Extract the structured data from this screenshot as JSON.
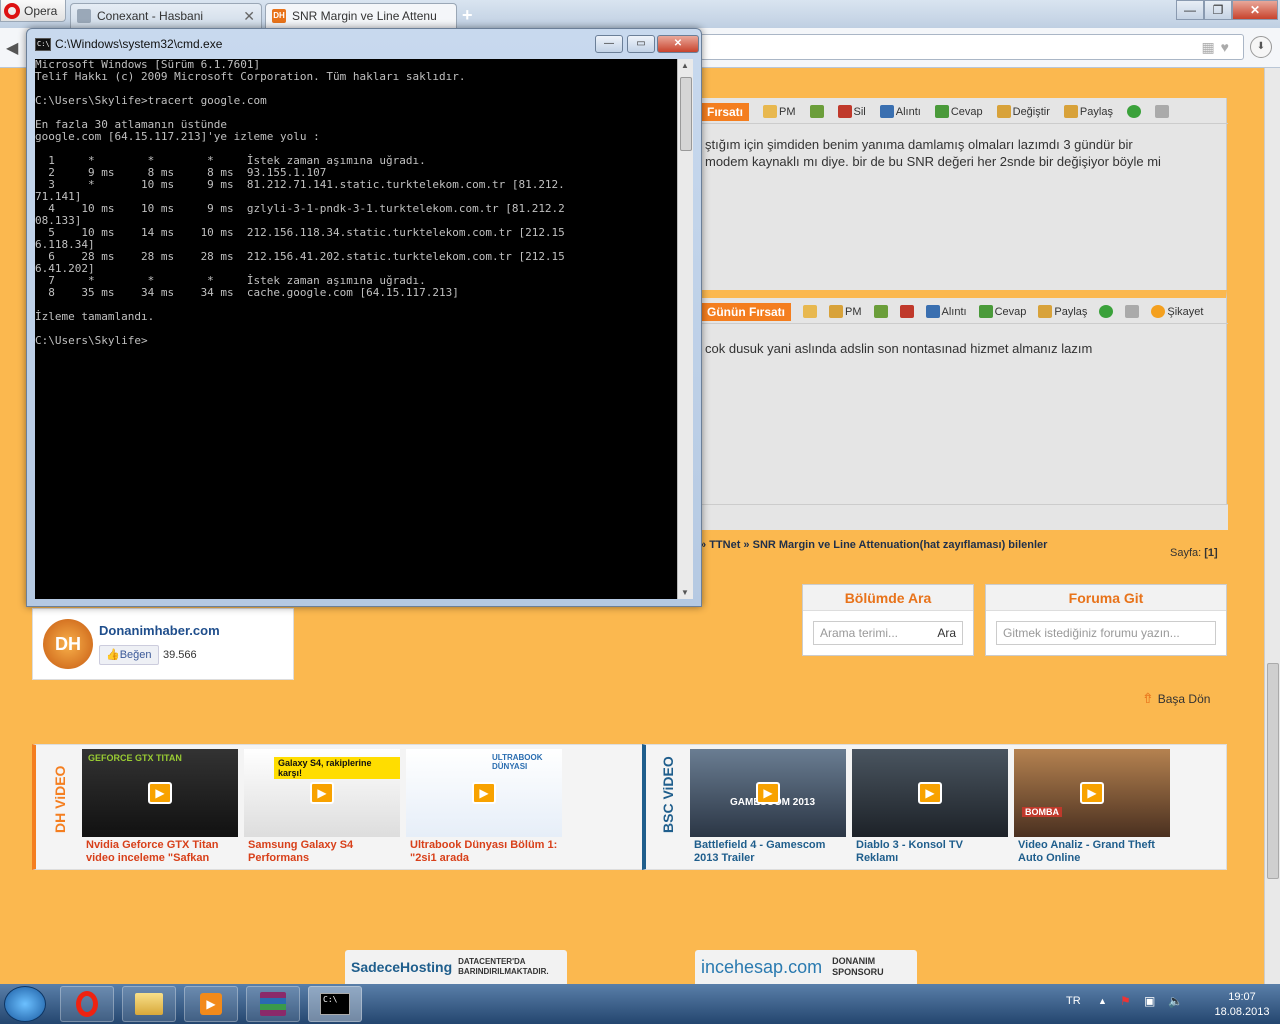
{
  "browser": {
    "opera_label": "Opera",
    "tabs": [
      {
        "label": "Conexant - Hasbani",
        "active": false
      },
      {
        "label": "SNR Margin ve Line Attenu",
        "active": true
      }
    ],
    "new_tab": "+",
    "window_controls": {
      "minimize": "—",
      "maximize": "❐",
      "close": "✕"
    }
  },
  "page": {
    "post1": {
      "firsat_label": "Fırsatı",
      "toolbar": [
        "PM",
        "Sil",
        "Alıntı",
        "Cevap",
        "Değiştir",
        "Paylaş"
      ],
      "text_line1": "ştığım için şimdiden benim yanıma damlamış olmaları lazımdı 3 gündür bir",
      "text_line2": " modem kaynaklı mı diye. bir de bu SNR değeri her 2snde bir değişiyor böyle mi"
    },
    "post2": {
      "firsat_label": "Günün Fırsatı",
      "toolbar": [
        "PM",
        "Alıntı",
        "Cevap",
        "Paylaş",
        "Şikayet"
      ],
      "text": "cok dusuk yani aslında adslin son nontasınad hizmet almanız lazım"
    },
    "breadcrumb": {
      "sep": "»",
      "ttnet": "TTNet",
      "current": "SNR Margin ve Line Attenuation(hat zayıflaması) bilenler"
    },
    "paging": {
      "label": "Sayfa:",
      "current": "[1]"
    },
    "search_box": {
      "title": "Bölümde Ara",
      "placeholder": "Arama terimi...",
      "button": "Ara"
    },
    "forum_box": {
      "title": "Foruma Git",
      "placeholder": "Gitmek istediğiniz forumu yazın..."
    },
    "facebook": {
      "name": "Donanimhaber.com",
      "like": "Beğen",
      "count": "39.566"
    },
    "back_to_top": "Başa Dön",
    "dh_video": {
      "label": "DH ViDEO",
      "items": [
        {
          "title": "Nvidia Geforce GTX Titan video inceleme \"Safkan",
          "thumb_text": "GEFORCE GTX TITAN"
        },
        {
          "title": "Samsung Galaxy S4 Performans",
          "thumb_text": "Galaxy S4, rakiplerine karşı!"
        },
        {
          "title": "Ultrabook Dünyası Bölüm 1: \"2si1 arada",
          "thumb_text": "ULTRABOOK DÜNYASI"
        }
      ]
    },
    "bsc_video": {
      "label": "BSC ViDEO",
      "items": [
        {
          "title": "Battlefield 4 - Gamescom 2013 Trailer",
          "thumb_text": "GAMESCOM 2013"
        },
        {
          "title": "Diablo 3 - Konsol TV Reklamı",
          "thumb_text": ""
        },
        {
          "title": "Video Analiz - Grand Theft Auto Online",
          "thumb_text": "BOMBA"
        }
      ]
    },
    "sponsor1": {
      "brand": "SadeceHosting",
      "text": "DATACENTER'DA BARINDIRILMAKTADIR."
    },
    "sponsor2": {
      "brand": "incehesap.com",
      "text": "DONANIM SPONSORU"
    }
  },
  "cmd": {
    "title": "C:\\Windows\\system32\\cmd.exe",
    "icon_text": "C:\\",
    "lines": [
      "Microsoft Windows [Sürüm 6.1.7601]",
      "Telif Hakkı (c) 2009 Microsoft Corporation. Tüm hakları saklıdır.",
      "",
      "C:\\Users\\Skylife>tracert google.com",
      "",
      "En fazla 30 atlamanın üstünde",
      "google.com [64.15.117.213]'ye izleme yolu :",
      "",
      "  1     *        *        *     İstek zaman aşımına uğradı.",
      "  2     9 ms     8 ms     8 ms  93.155.1.107",
      "  3     *       10 ms     9 ms  81.212.71.141.static.turktelekom.com.tr [81.212.",
      "71.141]",
      "  4    10 ms    10 ms     9 ms  gzlyli-3-1-pndk-3-1.turktelekom.com.tr [81.212.2",
      "08.133]",
      "  5    10 ms    14 ms    10 ms  212.156.118.34.static.turktelekom.com.tr [212.15",
      "6.118.34]",
      "  6    28 ms    28 ms    28 ms  212.156.41.202.static.turktelekom.com.tr [212.15",
      "6.41.202]",
      "  7     *        *        *     İstek zaman aşımına uğradı.",
      "  8    35 ms    34 ms    34 ms  cache.google.com [64.15.117.213]",
      "",
      "İzleme tamamlandı.",
      "",
      "C:\\Users\\Skylife>"
    ]
  },
  "taskbar": {
    "lang": "TR",
    "time": "19:07",
    "date": "18.08.2013"
  },
  "colors": {
    "accent": "#f47e1f",
    "page_bg": "#fbb84f",
    "link": "#1f4e8c",
    "video_title": "#d8401a"
  }
}
